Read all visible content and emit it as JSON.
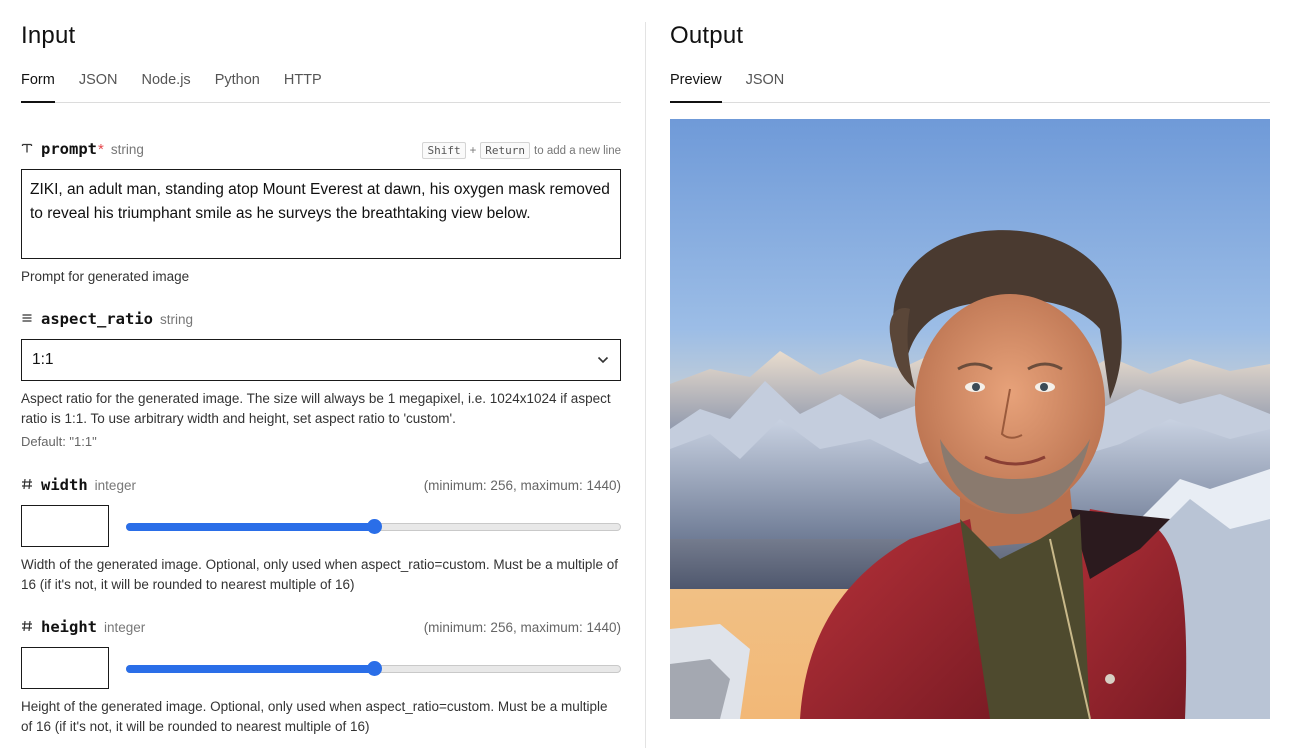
{
  "input": {
    "title": "Input",
    "tabs": [
      {
        "label": "Form",
        "active": true
      },
      {
        "label": "JSON",
        "active": false
      },
      {
        "label": "Node.js",
        "active": false
      },
      {
        "label": "Python",
        "active": false
      },
      {
        "label": "HTTP",
        "active": false
      }
    ],
    "prompt": {
      "icon": "text-type-icon",
      "name": "prompt",
      "required_mark": "*",
      "type": "string",
      "kbd_shift": "Shift",
      "kbd_plus": "+",
      "kbd_return": "Return",
      "kbd_suffix": "to add a new line",
      "value": "ZIKI, an adult man, standing atop Mount Everest at dawn, his oxygen mask removed to reveal his triumphant smile as he surveys the breathtaking view below.",
      "description": "Prompt for generated image"
    },
    "aspect_ratio": {
      "icon": "list-icon",
      "name": "aspect_ratio",
      "type": "string",
      "value": "1:1",
      "description": "Aspect ratio for the generated image. The size will always be 1 megapixel, i.e. 1024x1024 if aspect ratio is 1:1. To use arbitrary width and height, set aspect ratio to 'custom'.",
      "default": "Default: \"1:1\""
    },
    "width": {
      "icon": "hash-icon",
      "name": "width",
      "type": "integer",
      "range": "(minimum: 256, maximum: 1440)",
      "value": "",
      "slider_fraction": 0.5,
      "description": "Width of the generated image. Optional, only used when aspect_ratio=custom. Must be a multiple of 16 (if it's not, it will be rounded to nearest multiple of 16)"
    },
    "height": {
      "icon": "hash-icon",
      "name": "height",
      "type": "integer",
      "range": "(minimum: 256, maximum: 1440)",
      "value": "",
      "slider_fraction": 0.5,
      "description": "Height of the generated image. Optional, only used when aspect_ratio=custom. Must be a multiple of 16 (if it's not, it will be rounded to nearest multiple of 16)"
    }
  },
  "output": {
    "title": "Output",
    "tabs": [
      {
        "label": "Preview",
        "active": true
      },
      {
        "label": "JSON",
        "active": false
      }
    ]
  },
  "colors": {
    "accent": "#2a6ee8",
    "required": "#e5484d",
    "border": "#1a1a1a"
  }
}
